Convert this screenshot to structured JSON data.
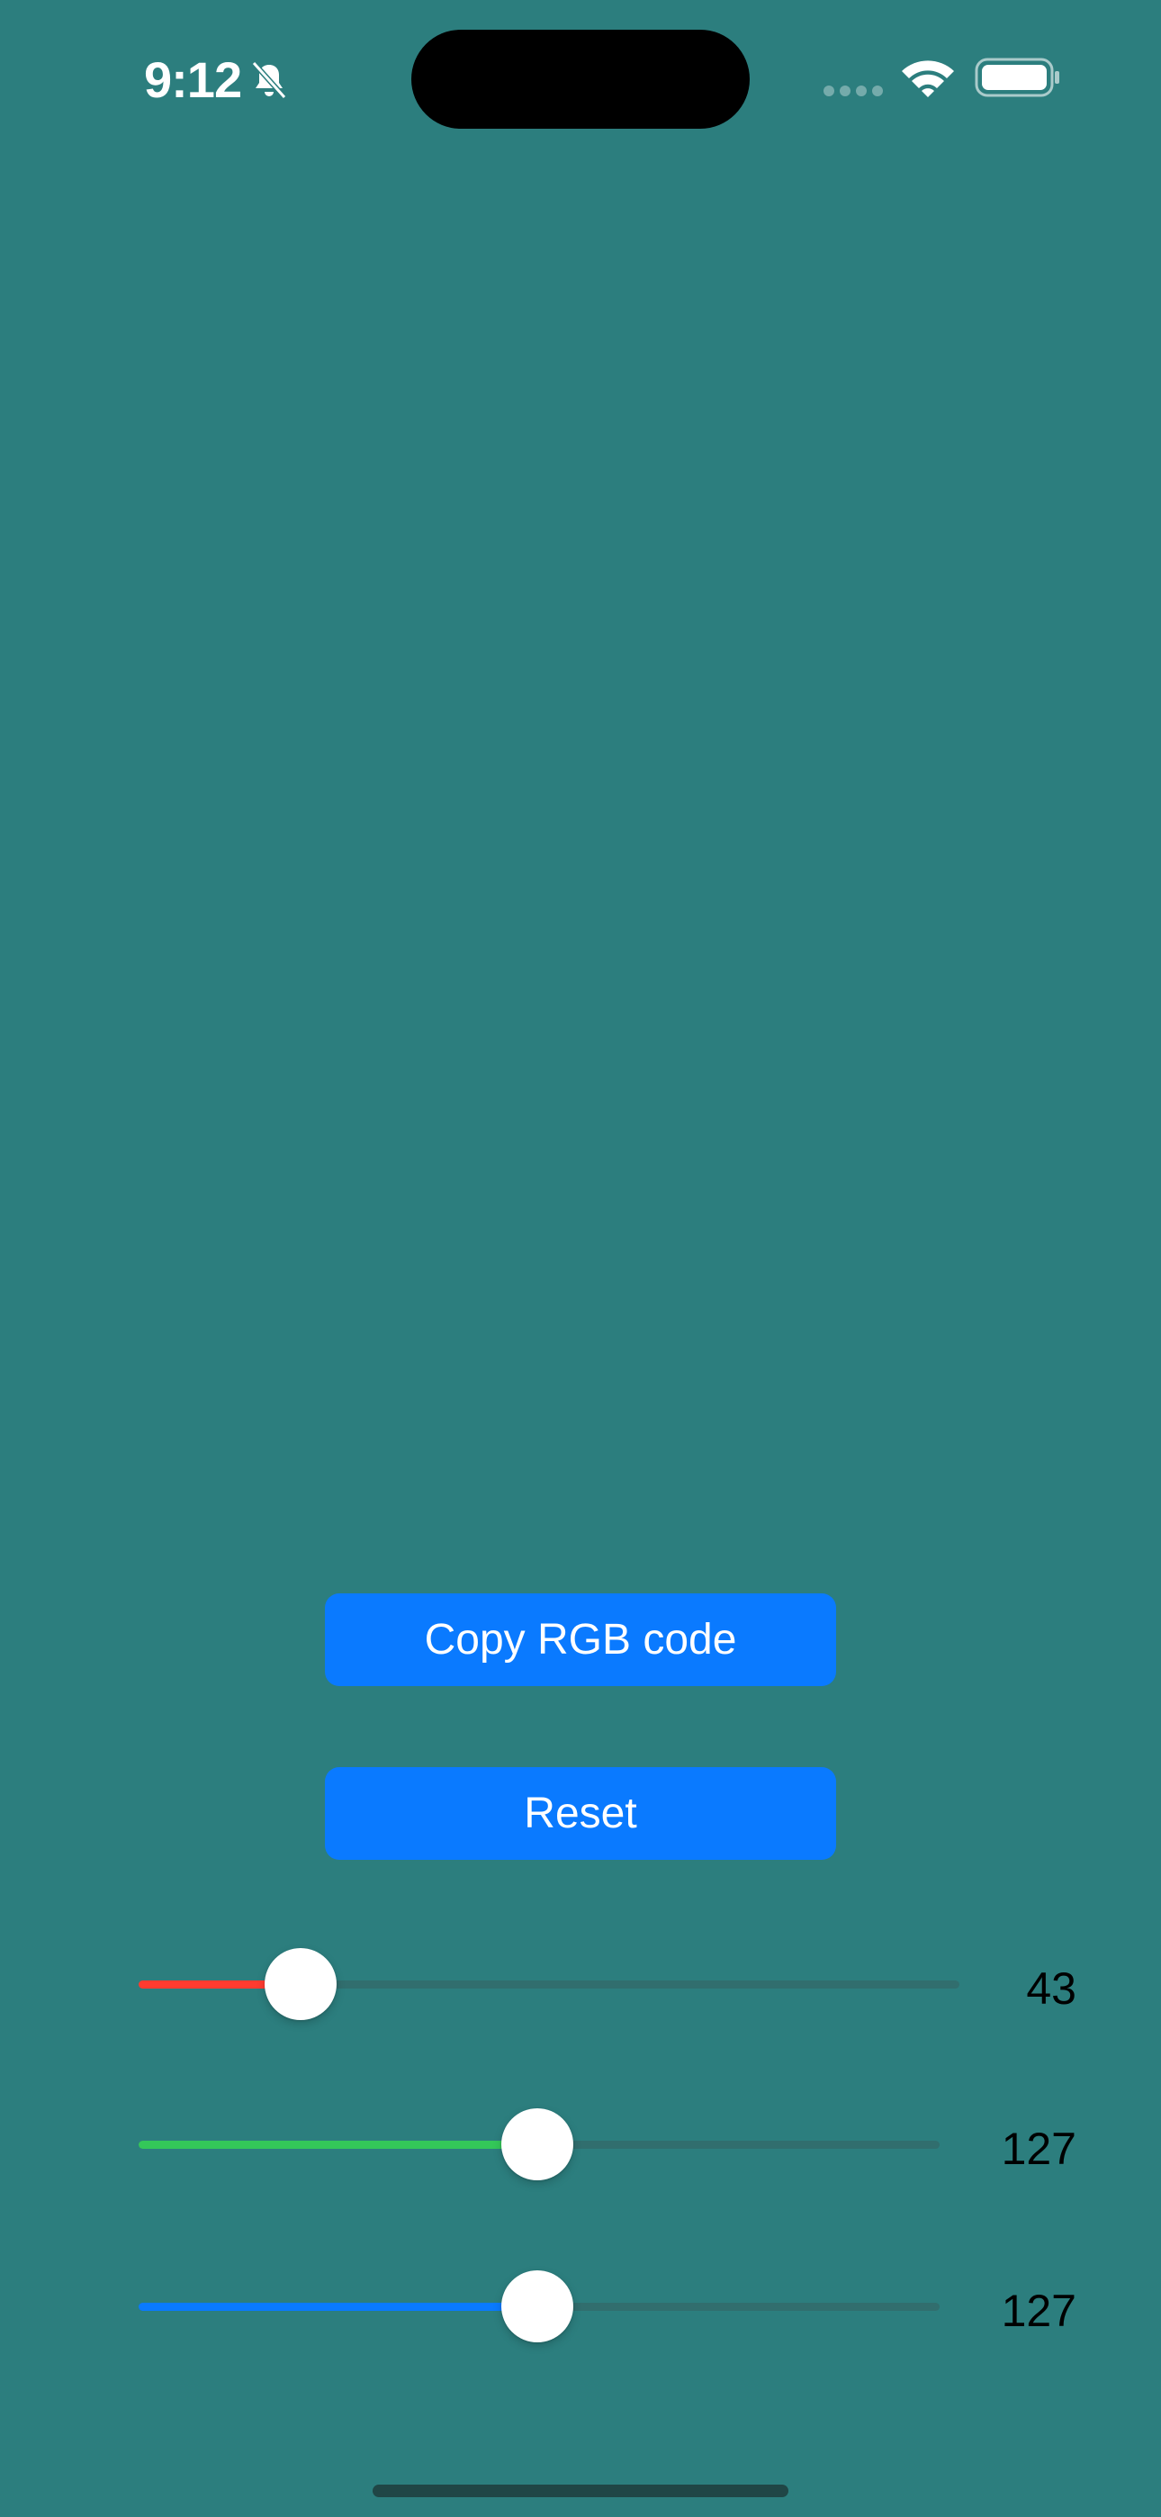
{
  "colors": {
    "background": "#2C7E7E",
    "button": "#0A7AFF",
    "red_slider": "#FF3B30",
    "green_slider": "#34C759",
    "blue_slider": "#0A7AFF"
  },
  "status_bar": {
    "time": "9:12",
    "icons": [
      "bell-slash-icon",
      "signal-icon",
      "wifi-icon",
      "battery-icon"
    ]
  },
  "buttons": {
    "copy_label": "Copy RGB code",
    "reset_label": "Reset"
  },
  "sliders": [
    {
      "name": "red",
      "value": "43",
      "fraction": 0.1686
    },
    {
      "name": "green",
      "value": "127",
      "fraction": 0.498
    },
    {
      "name": "blue",
      "value": "127",
      "fraction": 0.498
    }
  ]
}
